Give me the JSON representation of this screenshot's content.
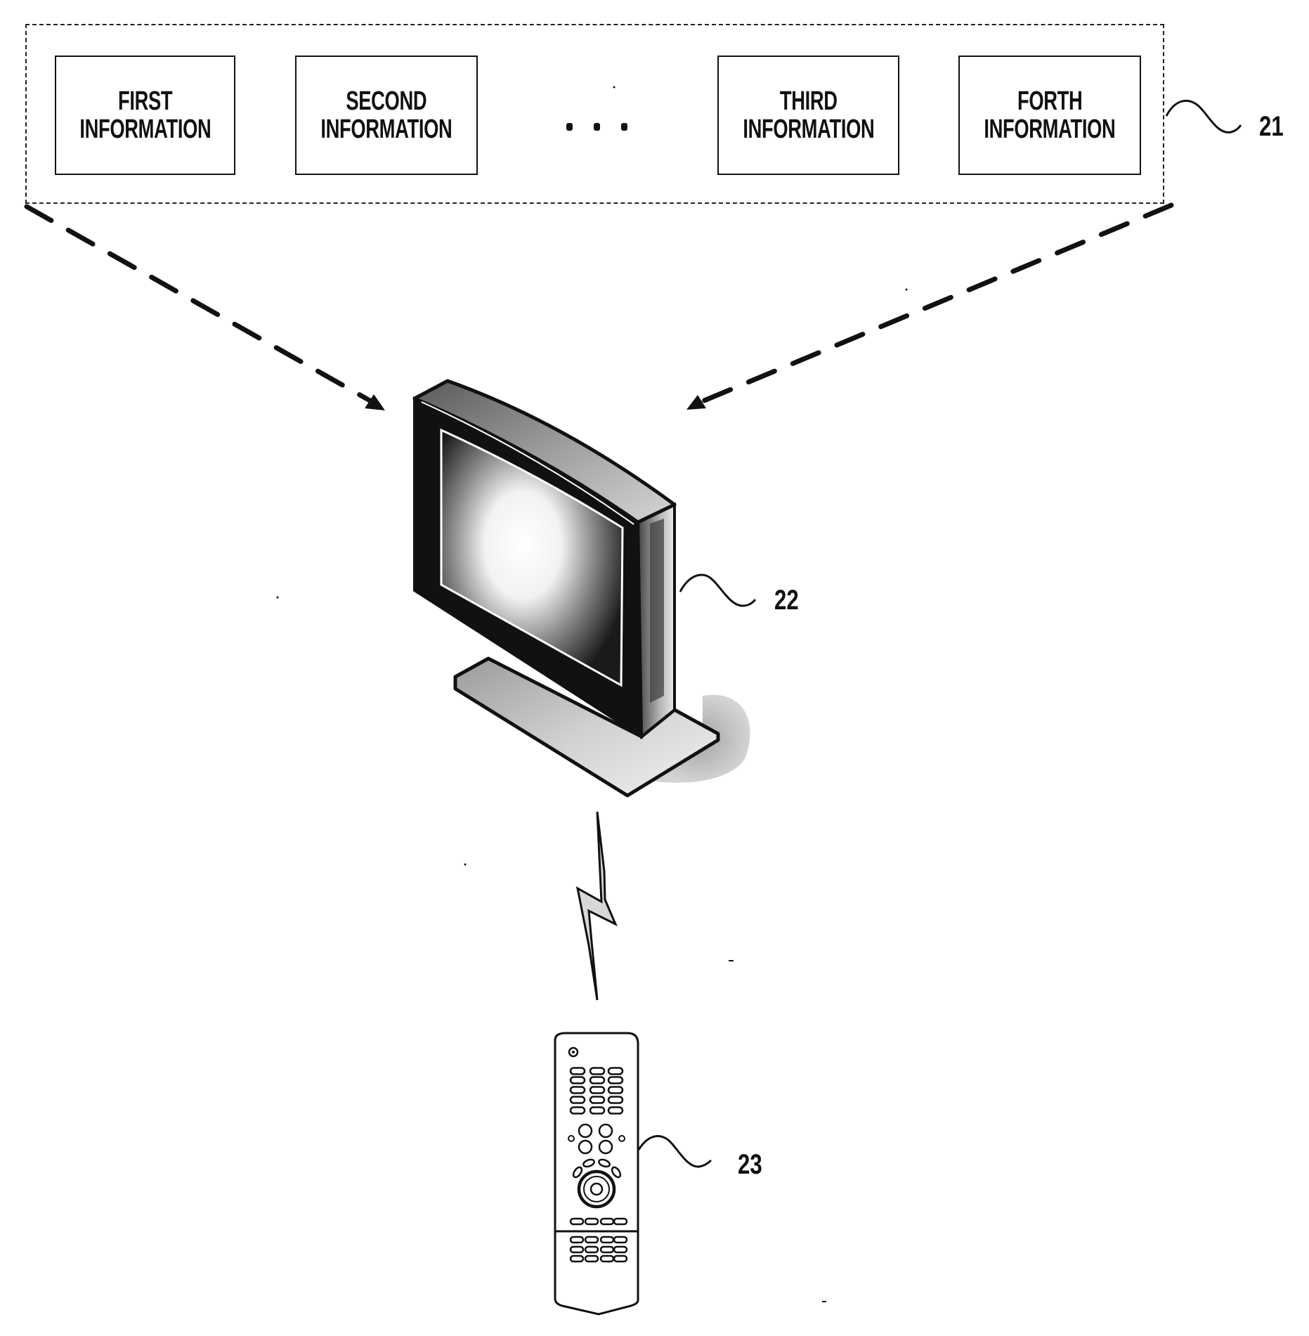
{
  "figure": {
    "type": "patent-system-diagram",
    "information_group": {
      "reference_numeral": "21",
      "items": [
        {
          "line1": "FIRST",
          "line2": "INFORMATION"
        },
        {
          "line1": "SECOND",
          "line2": "INFORMATION"
        },
        {
          "line1": "THIRD",
          "line2": "INFORMATION"
        },
        {
          "line1": "FORTH",
          "line2": "INFORMATION"
        }
      ],
      "ellipsis": "• • •"
    },
    "display_device": {
      "name": "television",
      "reference_numeral": "22"
    },
    "remote_control": {
      "name": "remote-controller",
      "reference_numeral": "23"
    },
    "connections": [
      {
        "from": "information_group",
        "to": "display_device",
        "style": "dashed-arrow"
      },
      {
        "from": "information_group",
        "to": "display_device",
        "style": "dashed-arrow"
      },
      {
        "from": "remote_control",
        "to": "display_device",
        "style": "wireless-lightning"
      }
    ],
    "colors": {
      "ink": "#111111",
      "background": "#ffffff",
      "tone": "#9a9a9a"
    }
  }
}
